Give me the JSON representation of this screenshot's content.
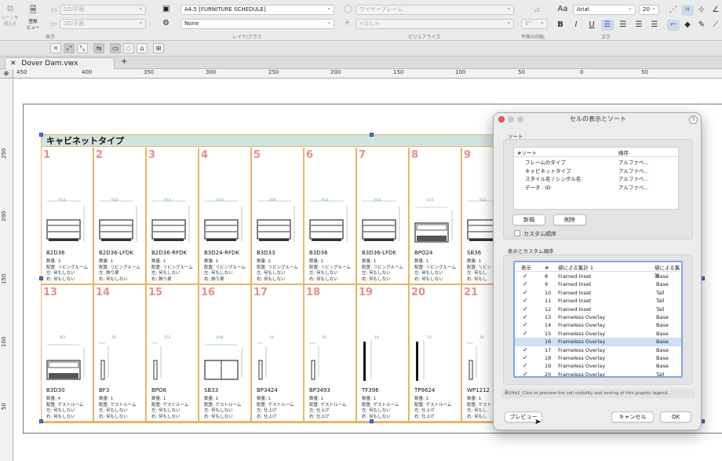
{
  "toolbar": {
    "left_btn1_line1": "シーンを",
    "left_btn1_line2": "適える",
    "left_btn2_line1": "登録",
    "left_btn2_line2": "ビュー",
    "view_select_1": "2D/平面",
    "view_select_2": "2D/平面",
    "view_label": "表示",
    "layer_select": "A4.5 [FURNITURE SCHEDULE]",
    "class_select": "None",
    "layer_class_label": "レイヤ/クラス",
    "visual_select_1": "ワイヤーフレーム",
    "visual_select_2": "<なし>",
    "visualize_label": "ビジュアライズ",
    "angle_value": "0°",
    "plane_rot_label": "平面の回転",
    "font_name": "Arial",
    "font_size": "20",
    "text_label": "文字"
  },
  "tab": {
    "name": "Dover Dam.vwx",
    "add": "+"
  },
  "ruler_top": [
    "450",
    "400",
    "350",
    "300",
    "250",
    "200",
    "150",
    "100",
    "50",
    "0",
    "50"
  ],
  "ruler_left": [
    "250",
    "200",
    "150",
    "100",
    "50"
  ],
  "schedule": {
    "title": "キャビネットタイプ",
    "row1": [
      {
        "num": "1",
        "name": "B2D36",
        "qty": "数量: 3",
        "place": "配置: リビングルーム",
        "left": "左: 何もしない",
        "right": "右: 何もしない",
        "dim": "914"
      },
      {
        "num": "2",
        "name": "B2D36-LFDK",
        "qty": "数量: 1",
        "place": "配置: リビングルーム",
        "left": "左: 飾り扉",
        "right": "右: 何もしない",
        "dim": "914"
      },
      {
        "num": "3",
        "name": "B2D36-RFDK",
        "qty": "数量: 1",
        "place": "配置: リビングルーム",
        "left": "左: 何もしない",
        "right": "右: 飾り扉",
        "dim": "914"
      },
      {
        "num": "4",
        "name": "B3D24-RFDK",
        "qty": "数量: 1",
        "place": "配置: リビングルーム",
        "left": "左: 何もしない",
        "right": "右: 飾り扉",
        "dim": "610"
      },
      {
        "num": "5",
        "name": "B3D33",
        "qty": "数量: 2",
        "place": "配置: リビングルーム",
        "left": "左: 何もしない",
        "right": "右: 何もしない",
        "dim": "838"
      },
      {
        "num": "6",
        "name": "B3D36",
        "qty": "数量: 1",
        "place": "配置: リビングルーム",
        "left": "左: 何もしない",
        "right": "右: 何もしない",
        "dim": "914"
      },
      {
        "num": "7",
        "name": "B3D36-LFDK",
        "qty": "数量: 1",
        "place": "配置: リビングルーム",
        "left": "左: 何もしない",
        "right": "右: 何もしない",
        "dim": "914"
      },
      {
        "num": "8",
        "name": "BPO24",
        "qty": "数量: 1",
        "place": "配置: リビングルーム",
        "left": "左: 何もしない",
        "right": "右: 何もしない",
        "dim": "610"
      },
      {
        "num": "9",
        "name": "SB36",
        "qty": "数量: 1",
        "place": "配置: リビン",
        "left": "左: 何もし",
        "right": "右: 何もし",
        "dim": "914"
      }
    ],
    "row2": [
      {
        "num": "13",
        "name": "B3D30",
        "qty": "数量: 4",
        "place": "配置: ゲストルーム",
        "left": "左: 何もしない",
        "right": "右: 何もしない",
        "dim": "762"
      },
      {
        "num": "14",
        "name": "BF3",
        "qty": "数量: 1",
        "place": "配置: ゲストルーム",
        "left": "左: 何もしない",
        "right": "右: 何もしない",
        "dim": "76"
      },
      {
        "num": "15",
        "name": "BPO6",
        "qty": "数量: 1",
        "place": "配置: ゲストルーム",
        "left": "左: 何もしない",
        "right": "右: 何もしない",
        "dim": "152"
      },
      {
        "num": "16",
        "name": "SB33",
        "qty": "数量: 1",
        "place": "配置: ゲストルーム",
        "left": "左: 何もしない",
        "right": "右: 何もしない",
        "dim": "838"
      },
      {
        "num": "17",
        "name": "BP3424",
        "qty": "数量: 1",
        "place": "配置: ゲストルーム",
        "left": "左: 仕上げ",
        "right": "右: 仕上げ",
        "dim": "19"
      },
      {
        "num": "18",
        "name": "BP3493",
        "qty": "数量: 1",
        "place": "配置: ゲストルーム",
        "left": "左: 仕上げ",
        "right": "右: 仕上げ",
        "dim": "19"
      },
      {
        "num": "19",
        "name": "TF396",
        "qty": "数量: 1",
        "place": "配置: ゲストルーム",
        "left": "左: 何もしない",
        "right": "右: 何もしない",
        "dim": "19"
      },
      {
        "num": "20",
        "name": "TP9624",
        "qty": "数量: 1",
        "place": "配置: ゲストルーム",
        "left": "左: 仕上げ",
        "right": "右: 仕上げ",
        "dim": "19"
      },
      {
        "num": "21",
        "name": "WP1212",
        "qty": "数量: 1",
        "place": "配置: ゲスト",
        "left": "左: 何もし",
        "right": "右: 何もし",
        "dim": "19"
      }
    ]
  },
  "dialog": {
    "title": "セルの表示とソート",
    "help": "?",
    "sort_group": "ソート",
    "sort_headers": {
      "col1": "#ソート",
      "col2": "順序"
    },
    "sort_rows": [
      {
        "name": "フレームのタイプ",
        "order": "アルファベ..."
      },
      {
        "name": "キャビネットタイプ",
        "order": "アルファベ..."
      },
      {
        "name": "スタイル名 / シンボル名",
        "order": "アルファベ..."
      },
      {
        "name": "データ : ID",
        "order": "アルファベ..."
      }
    ],
    "new_button": "新規",
    "delete_button": "削除",
    "custom_order_label": "カスタム順序",
    "vis_group": "表示とカスタム順序",
    "vis_headers": {
      "show": "表示",
      "num": "#",
      "agg1": "値による集計 1",
      "agg2": "値による集計"
    },
    "vis_rows": [
      {
        "check": "✓",
        "num": "8",
        "type": "Framed Inset",
        "val": "Base"
      },
      {
        "check": "✓",
        "num": "9",
        "type": "Framed Inset",
        "val": "Base"
      },
      {
        "check": "✓",
        "num": "10",
        "type": "Framed Inset",
        "val": "Tall"
      },
      {
        "check": "✓",
        "num": "11",
        "type": "Framed Inset",
        "val": "Tall"
      },
      {
        "check": "✓",
        "num": "12",
        "type": "Framed Inset",
        "val": "Tall"
      },
      {
        "check": "✓",
        "num": "13",
        "type": "Frameless Overlay",
        "val": "Base"
      },
      {
        "check": "✓",
        "num": "14",
        "type": "Frameless Overlay",
        "val": "Base"
      },
      {
        "check": "✓",
        "num": "15",
        "type": "Frameless Overlay",
        "val": "Base"
      },
      {
        "check": "",
        "num": "16",
        "type": "Frameless Overlay",
        "val": "Base"
      },
      {
        "check": "✓",
        "num": "17",
        "type": "Frameless Overlay",
        "val": "Base"
      },
      {
        "check": "✓",
        "num": "18",
        "type": "Frameless Overlay",
        "val": "Base"
      },
      {
        "check": "✓",
        "num": "19",
        "type": "Frameless Overlay",
        "val": "Base"
      },
      {
        "check": "✓",
        "num": "20",
        "type": "Frameless Overlay",
        "val": "Tall"
      }
    ],
    "note": "新24b2_Click to preview the cell visibility and sorting of this graphic legend.",
    "preview_button": "プレビュー",
    "cancel_button": "キャンセル",
    "ok_button": "OK"
  },
  "colors": {
    "schedule_border": "#e9b46a",
    "schedule_header": "#cfe3e0",
    "cell_number": "#e58f8f",
    "selection_handle": "#4d7ad0",
    "list_highlight": "#cfe0f7"
  }
}
